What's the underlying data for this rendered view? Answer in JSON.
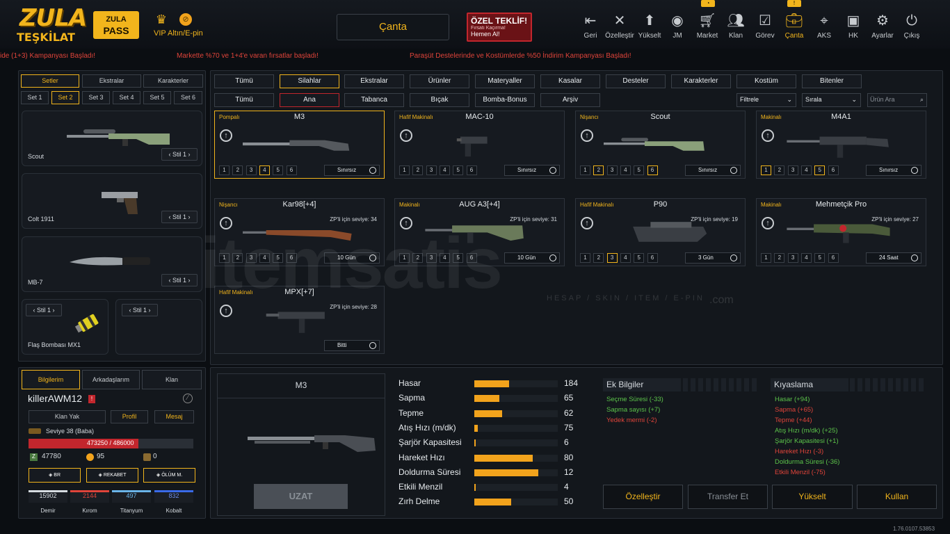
{
  "header": {
    "logo_line1": "ZULA",
    "logo_line2": "TEŞKİLAT",
    "zula_pass_line1": "ZULA",
    "zula_pass_line2": "PASS",
    "vip_label": "VIP",
    "altin_label": "Altın/E-pin",
    "canta_title": "Çanta",
    "offer": {
      "title": "ÖZEL TEKLİF!",
      "subtitle": "Fırsatı Kaçırma!",
      "cta": "Hemen Al!"
    },
    "nav": [
      {
        "label": "Geri",
        "icon": "back-icon"
      },
      {
        "label": "Özelleştir",
        "icon": "tools-icon"
      },
      {
        "label": "Yükselt",
        "icon": "rank-up-icon"
      },
      {
        "label": "JM",
        "icon": "coins-icon"
      },
      {
        "label": "Market",
        "icon": "cart-icon"
      },
      {
        "label": "Klan",
        "icon": "clan-icon"
      },
      {
        "label": "Görev",
        "icon": "clipboard-icon"
      },
      {
        "label": "Çanta",
        "icon": "bag-icon"
      },
      {
        "label": "AKS",
        "icon": "crosshair-icon"
      },
      {
        "label": "HK",
        "icon": "wallet-icon"
      },
      {
        "label": "Ayarlar",
        "icon": "gear-icon"
      },
      {
        "label": "Çıkış",
        "icon": "power-icon"
      }
    ]
  },
  "tickers": [
    "ide (1+3) Kampanyası Başladı!",
    "Markette %70 ve 1+4'e varan fırsatlar başladı!",
    "Paraşüt Destelerinde ve Kostümlerde %50 İndirim Kampanyası Başladı!"
  ],
  "left": {
    "tabs": [
      "Setler",
      "Ekstralar",
      "Karakterler"
    ],
    "sets": [
      "Set 1",
      "Set 2",
      "Set 3",
      "Set 4",
      "Set 5",
      "Set 6"
    ],
    "items": [
      {
        "name": "Scout",
        "stil": "Stil 1"
      },
      {
        "name": "Colt 1911",
        "stil": "Stil 1"
      },
      {
        "name": "MB-7",
        "stil": "Stil 1"
      },
      {
        "name": "Flaş Bombası MX1",
        "stil": "Stil 1"
      },
      {
        "name": "",
        "stil": "Stil 1"
      }
    ]
  },
  "profile": {
    "tabs": [
      "Bilgilerim",
      "Arkadaşlarım",
      "Klan"
    ],
    "username": "killerAWM12",
    "buttons": [
      "Klan Yak",
      "Profil",
      "Mesaj"
    ],
    "level": "Seviye 38 (Baba)",
    "xp_text": "473250 / 486000",
    "xp_fraction": 0.974,
    "zp": "47780",
    "gold": "95",
    "other": "0",
    "modes": [
      "BR",
      "REKABET",
      "ÖLÜM M."
    ],
    "ranks": [
      {
        "name": "Demir",
        "value": "15902",
        "color": "#d6dbe0"
      },
      {
        "name": "Kırom",
        "value": "2144",
        "color": "#e0443a"
      },
      {
        "name": "Titanyum",
        "value": "497",
        "color": "#6ab4e8"
      },
      {
        "name": "Kobalt",
        "value": "832",
        "color": "#3a6ae8"
      }
    ]
  },
  "filters": {
    "row1": [
      "Tümü",
      "Silahlar",
      "Ekstralar",
      "Ürünler",
      "Materyaller",
      "Kasalar",
      "Desteler",
      "Karakterler",
      "Kostüm",
      "Bitenler"
    ],
    "row2": [
      "Tümü",
      "Ana",
      "Tabanca",
      "Bıçak",
      "Bomba-Bonus",
      "Arşiv"
    ],
    "filter_select": "Filtrele",
    "sort_select": "Sırala",
    "search_placeholder": "Ürün Ara"
  },
  "weapons": [
    {
      "category": "Pompalı",
      "name": "M3",
      "zp": "",
      "duration": "Sınırsız",
      "active_levels": [
        4
      ]
    },
    {
      "category": "Hafif Makinalı",
      "name": "MAC-10",
      "zp": "",
      "duration": "Sınırsız",
      "active_levels": []
    },
    {
      "category": "Nişancı",
      "name": "Scout",
      "zp": "",
      "duration": "Sınırsız",
      "active_levels": [
        2,
        6
      ]
    },
    {
      "category": "Makinalı",
      "name": "M4A1",
      "zp": "",
      "duration": "Sınırsız",
      "active_levels": [
        1,
        5
      ]
    },
    {
      "category": "Nişancı",
      "name": "Kar98[+4]",
      "zp": "ZP'li için seviye: 34",
      "duration": "10 Gün",
      "active_levels": []
    },
    {
      "category": "Makinalı",
      "name": "AUG A3[+4]",
      "zp": "ZP'li için seviye: 31",
      "duration": "10 Gün",
      "active_levels": []
    },
    {
      "category": "Hafif Makinalı",
      "name": "P90",
      "zp": "ZP'li için seviye: 19",
      "duration": "3 Gün",
      "active_levels": [
        3
      ]
    },
    {
      "category": "Makinalı",
      "name": "Mehmetçik Pro",
      "zp": "ZP'li için seviye: 27",
      "duration": "24 Saat",
      "active_levels": []
    },
    {
      "category": "Hafif Makinalı",
      "name": "MPX[+7]",
      "zp": "ZP'li için seviye: 28",
      "duration": "Bitti",
      "active_levels": null
    }
  ],
  "detail": {
    "name": "M3",
    "extend_button": "UZAT",
    "stats": [
      {
        "label": "Hasar",
        "value": "184",
        "fill": 0.42
      },
      {
        "label": "Sapma",
        "value": "65",
        "fill": 0.3
      },
      {
        "label": "Tepme",
        "value": "62",
        "fill": 0.33
      },
      {
        "label": "Atış Hızı (m/dk)",
        "value": "75",
        "fill": 0.04
      },
      {
        "label": "Şarjör Kapasitesi",
        "value": "6",
        "fill": 0.02
      },
      {
        "label": "Hareket Hızı",
        "value": "80",
        "fill": 0.7
      },
      {
        "label": "Doldurma Süresi",
        "value": "12",
        "fill": 0.77
      },
      {
        "label": "Etkili Menzil",
        "value": "4",
        "fill": 0.02
      },
      {
        "label": "Zırh Delme",
        "value": "50",
        "fill": 0.44
      }
    ],
    "ek_title": "Ek Bilgiler",
    "ek": [
      {
        "text": "Seçme Süresi (-33)",
        "color": "#5cc44a"
      },
      {
        "text": "Sapma sayısı (+7)",
        "color": "#5cc44a"
      },
      {
        "text": "Yedek mermi (-2)",
        "color": "#e0443a"
      }
    ],
    "kiyas_title": "Kıyaslama",
    "kiyas": [
      {
        "text": "Hasar (+94)",
        "color": "#5cc44a"
      },
      {
        "text": "Sapma (+65)",
        "color": "#e0443a"
      },
      {
        "text": "Tepme (+44)",
        "color": "#e0443a"
      },
      {
        "text": "Atış Hızı (m/dk) (+25)",
        "color": "#5cc44a"
      },
      {
        "text": "Şarjör Kapasitesi (+1)",
        "color": "#5cc44a"
      },
      {
        "text": "Hareket Hızı (-3)",
        "color": "#e0443a"
      },
      {
        "text": "Doldurma Süresi (-36)",
        "color": "#5cc44a"
      },
      {
        "text": "Etkili Menzil (-75)",
        "color": "#e0443a"
      }
    ],
    "buttons": [
      "Özelleştir",
      "Transfer Et",
      "Yükselt",
      "Kullan"
    ]
  },
  "watermark": {
    "main": "itemsatis",
    "sub": "HESAP / SKIN / ITEM / E-PIN",
    "dotcom": ".com"
  },
  "version": "1.76.0107.53853",
  "colors": {
    "accent": "#f2b51c",
    "danger": "#e0443a",
    "positive": "#5cc44a"
  }
}
